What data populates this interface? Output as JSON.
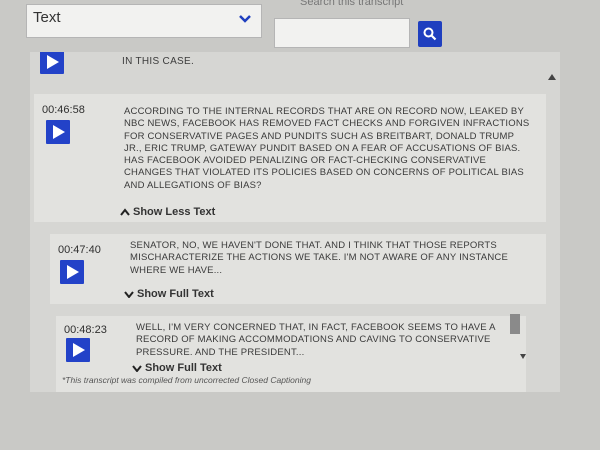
{
  "filter": {
    "selected": "Text"
  },
  "search": {
    "label": "Search this transcript"
  },
  "entries": [
    {
      "text": "IN THIS CASE."
    },
    {
      "time": "00:46:58",
      "text": "ACCORDING TO THE INTERNAL RECORDS THAT ARE ON RECORD NOW, LEAKED BY NBC NEWS, FACEBOOK HAS REMOVED FACT CHECKS AND FORGIVEN INFRACTIONS FOR CONSERVATIVE PAGES AND PUNDITS SUCH AS BREITBART, DONALD TRUMP JR., ERIC TRUMP, GATEWAY PUNDIT BASED ON A FEAR OF ACCUSATIONS OF BIAS. HAS FACEBOOK AVOIDED PENALIZING OR FACT-CHECKING CONSERVATIVE CHANGES THAT VIOLATED ITS POLICIES BASED ON CONCERNS OF POLITICAL BIAS AND ALLEGATIONS OF BIAS?",
      "toggle": "Show Less Text"
    },
    {
      "time": "00:47:40",
      "text": "SENATOR, NO, WE HAVEN'T DONE THAT. AND I THINK THAT THOSE REPORTS MISCHARACTERIZE THE ACTIONS WE TAKE. I'M NOT AWARE OF ANY INSTANCE WHERE WE HAVE...",
      "toggle": "Show Full Text"
    },
    {
      "time": "00:48:23",
      "text": "WELL, I'M VERY CONCERNED THAT, IN FACT, FACEBOOK SEEMS TO HAVE A RECORD OF MAKING ACCOMMODATIONS AND CAVING TO CONSERVATIVE PRESSURE. AND THE PRESIDENT...",
      "toggle": "Show Full Text"
    }
  ],
  "footnote": "*This transcript was compiled from uncorrected Closed Captioning",
  "colors": {
    "accent": "#2342c8",
    "panel": "#d6d6d3",
    "card": "#e2e2df"
  }
}
